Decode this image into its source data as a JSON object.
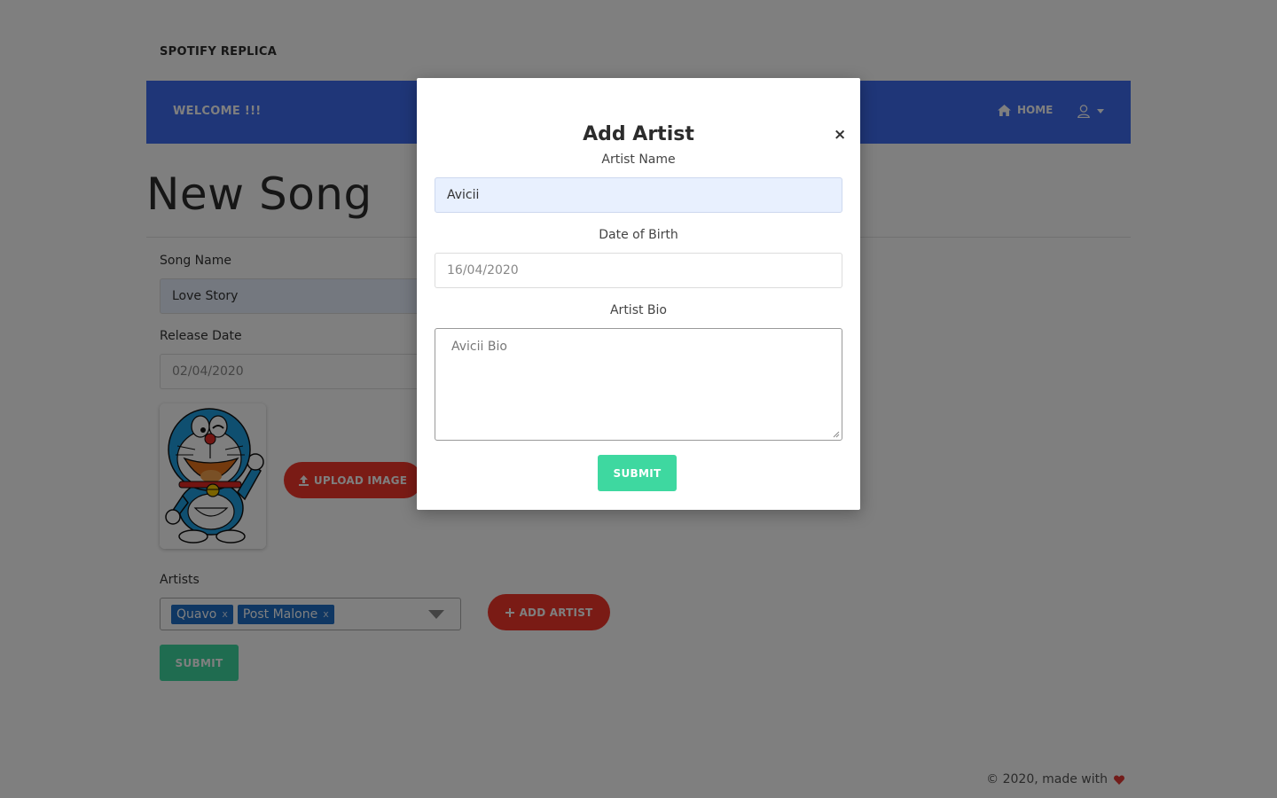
{
  "brand": "SPOTIFY REPLICA",
  "navbar": {
    "welcome": "WELCOME !!!",
    "home_label": "HOME",
    "home_icon": "home-icon",
    "user_icon": "user-icon",
    "bg_color": "#3e6df0"
  },
  "page": {
    "title": "New Song"
  },
  "form": {
    "song_name_label": "Song Name",
    "song_name_value": "Love Story",
    "release_date_label": "Release Date",
    "release_date_value": "02/04/2020",
    "upload_label": "UPLOAD IMAGE",
    "artists_label": "Artists",
    "artists": [
      {
        "name": "Quavo",
        "remove": "x"
      },
      {
        "name": "Post Malone",
        "remove": "x"
      }
    ],
    "add_artist_label": "ADD ARTIST",
    "submit_label": "SUBMIT"
  },
  "modal": {
    "title": "Add Artist",
    "close": "×",
    "artist_name_label": "Artist Name",
    "artist_name_value": "Avicii",
    "dob_label": "Date of Birth",
    "dob_value": "16/04/2020",
    "bio_label": "Artist Bio",
    "bio_value": "Avicii Bio",
    "submit_label": "SUBMIT"
  },
  "footer": {
    "text": "© 2020, made with",
    "heart_icon": "heart-icon",
    "heart_color": "#e53935"
  },
  "colors": {
    "accent_red": "#f5362b",
    "accent_green": "#3ed8a0",
    "tag_blue": "#1f6fc6"
  }
}
